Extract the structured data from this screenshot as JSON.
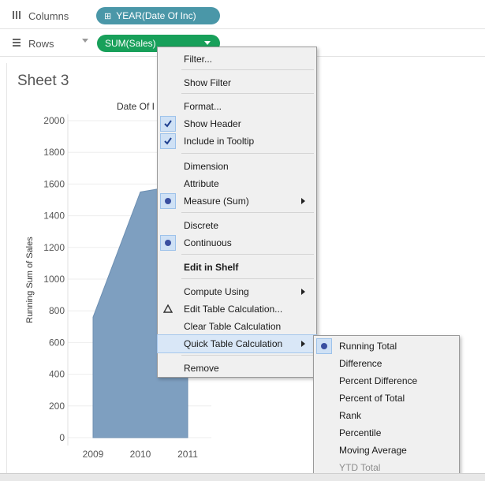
{
  "shelves": {
    "columns_label": "Columns",
    "columns_pill": "YEAR(Date Of Inc)",
    "columns_pill_prefix": "⊞",
    "rows_label": "Rows",
    "rows_pill": "SUM(Sales)"
  },
  "sheet": {
    "title": "Sheet 3"
  },
  "chart_data": {
    "type": "area",
    "title": "Date Of I",
    "x": [
      "2009",
      "2010",
      "2011"
    ],
    "values": [
      760,
      1550,
      1600
    ],
    "ylabel": "Running Sum of Sales",
    "ylim": [
      0,
      2000
    ],
    "yticks": [
      "2000",
      "1800",
      "1600",
      "1400",
      "1200",
      "1000",
      "800",
      "600",
      "400",
      "200",
      "0"
    ],
    "color": "#7e9fc0"
  },
  "context_menu": {
    "items": [
      {
        "label": "Filter..."
      },
      {
        "label": "Show Filter"
      },
      {
        "label": "Format..."
      },
      {
        "label": "Show Header",
        "checked": true
      },
      {
        "label": "Include in Tooltip",
        "checked": true
      },
      {
        "label": "Dimension"
      },
      {
        "label": "Attribute"
      },
      {
        "label": "Measure (Sum)",
        "selected": true,
        "submenu": true
      },
      {
        "label": "Discrete"
      },
      {
        "label": "Continuous",
        "selected": true
      },
      {
        "label": "Edit in Shelf",
        "bold": true
      },
      {
        "label": "Compute Using",
        "submenu": true
      },
      {
        "label": "Edit Table Calculation...",
        "icon": "delta-icon"
      },
      {
        "label": "Clear Table Calculation"
      },
      {
        "label": "Quick Table Calculation",
        "submenu": true,
        "highlighted": true
      },
      {
        "label": "Remove"
      }
    ]
  },
  "quick_table_menu": {
    "items": [
      {
        "label": "Running Total",
        "selected": true
      },
      {
        "label": "Difference"
      },
      {
        "label": "Percent Difference"
      },
      {
        "label": "Percent of Total"
      },
      {
        "label": "Rank"
      },
      {
        "label": "Percentile"
      },
      {
        "label": "Moving Average"
      },
      {
        "label": "YTD Total",
        "disabled": true
      }
    ]
  }
}
